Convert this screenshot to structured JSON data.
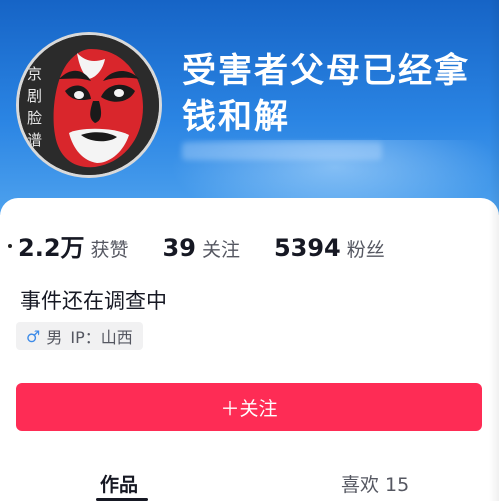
{
  "profile": {
    "nickname": "受害者父母已经拿钱和解",
    "avatar": {
      "name": "peking-opera-mask-avatar",
      "text": "京剧脸谱",
      "colors": {
        "mask_red": "#d9262c",
        "mask_black": "#1a1a1a",
        "mask_white": "#f4f4f4",
        "frame": "#d9d9d9"
      }
    },
    "signature": "事件还在调查中",
    "tags": {
      "gender": {
        "icon": "male-icon",
        "label": "男"
      },
      "ip": {
        "label": "IP：山西"
      }
    }
  },
  "stats": [
    {
      "value": "2.2万",
      "label": "获赞"
    },
    {
      "value": "39",
      "label": "关注"
    },
    {
      "value": "5394",
      "label": "粉丝"
    }
  ],
  "actions": {
    "follow_label": "＋关注"
  },
  "tabs": [
    {
      "label": "作品",
      "active": true
    },
    {
      "label": "喜欢 15",
      "active": false
    }
  ],
  "colors": {
    "header_blue": "#2a84e3",
    "accent_red": "#fe2c55",
    "text_primary": "#161823",
    "text_secondary": "#555761",
    "tag_bg": "#f1f1f2",
    "gender_blue": "#3d8be8"
  }
}
